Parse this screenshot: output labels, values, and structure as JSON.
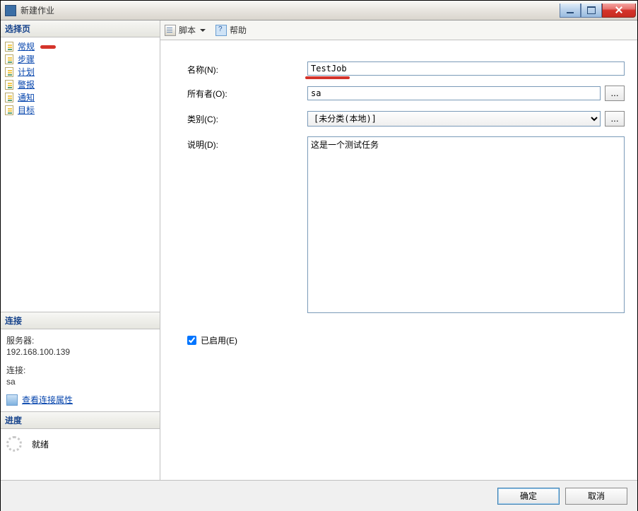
{
  "window": {
    "title": "新建作业"
  },
  "sidebar": {
    "pages_header": "选择页",
    "items": [
      {
        "label": "常规"
      },
      {
        "label": "步骤"
      },
      {
        "label": "计划"
      },
      {
        "label": "警报"
      },
      {
        "label": "通知"
      },
      {
        "label": "目标"
      }
    ],
    "connection": {
      "header": "连接",
      "server_label": "服务器:",
      "server_value": "192.168.100.139",
      "conn_label": "连接:",
      "conn_value": "sa",
      "view_props": "查看连接属性"
    },
    "progress": {
      "header": "进度",
      "status": "就绪"
    }
  },
  "toolbar": {
    "script_label": "脚本",
    "help_label": "帮助"
  },
  "form": {
    "name_label": "名称(N):",
    "name_value": "TestJob",
    "owner_label": "所有者(O):",
    "owner_value": "sa",
    "category_label": "类别(C):",
    "category_value": "[未分类(本地)]",
    "desc_label": "说明(D):",
    "desc_value": "这是一个测试任务",
    "enabled_label": "已启用(E)",
    "ellipsis": "..."
  },
  "footer": {
    "ok": "确定",
    "cancel": "取消"
  }
}
